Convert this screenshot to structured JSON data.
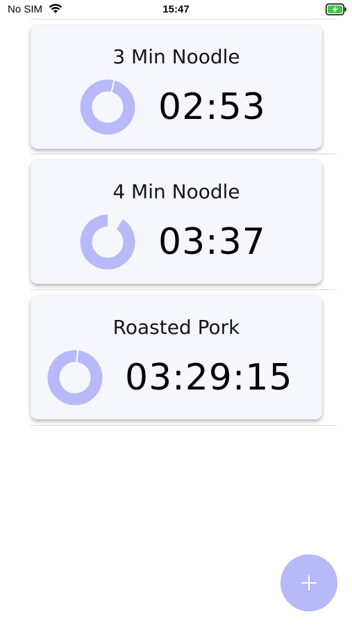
{
  "status_bar": {
    "carrier": "No SIM",
    "time": "15:47",
    "icons": [
      "wifi-icon",
      "battery-charging-icon"
    ],
    "battery_color": "#3ccc3c"
  },
  "timers": [
    {
      "title": "3 Min Noodle",
      "time": "02:53",
      "progress_remaining": 0.96
    },
    {
      "title": "4 Min Noodle",
      "time": "03:37",
      "progress_remaining": 0.9
    },
    {
      "title": "Roasted Pork",
      "time": "03:29:15",
      "progress_remaining": 0.98
    }
  ],
  "add_button": {
    "label": "+",
    "icon": "plus-icon"
  },
  "colors": {
    "accent": "#b7b9f8",
    "card_background": "#f6f6fd",
    "ring_gap": "#ffffff"
  }
}
